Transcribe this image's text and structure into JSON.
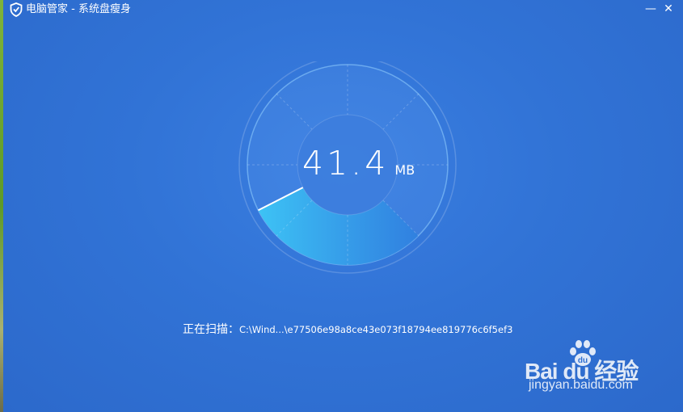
{
  "window": {
    "title": "电脑管家 - 系统盘瘦身",
    "minimize_glyph": "—",
    "close_glyph": "✕"
  },
  "scan": {
    "value": "41.4",
    "unit": "MB",
    "progress_fraction": 0.3,
    "status_label": "正在扫描：",
    "status_path": "C:\\Wind...\\e77506e98a8ce43e073f18794ee819776c6f5ef3"
  },
  "watermark": {
    "logo_text": "Bai du 经验",
    "url": "jingyan.baidu.com"
  },
  "colors": {
    "background": "#3173d6",
    "progress_start": "#3dc3f5",
    "progress_end": "#2f80e0"
  },
  "icons": {
    "app_logo": "shield-check-icon",
    "paw": "baidu-paw-icon"
  }
}
